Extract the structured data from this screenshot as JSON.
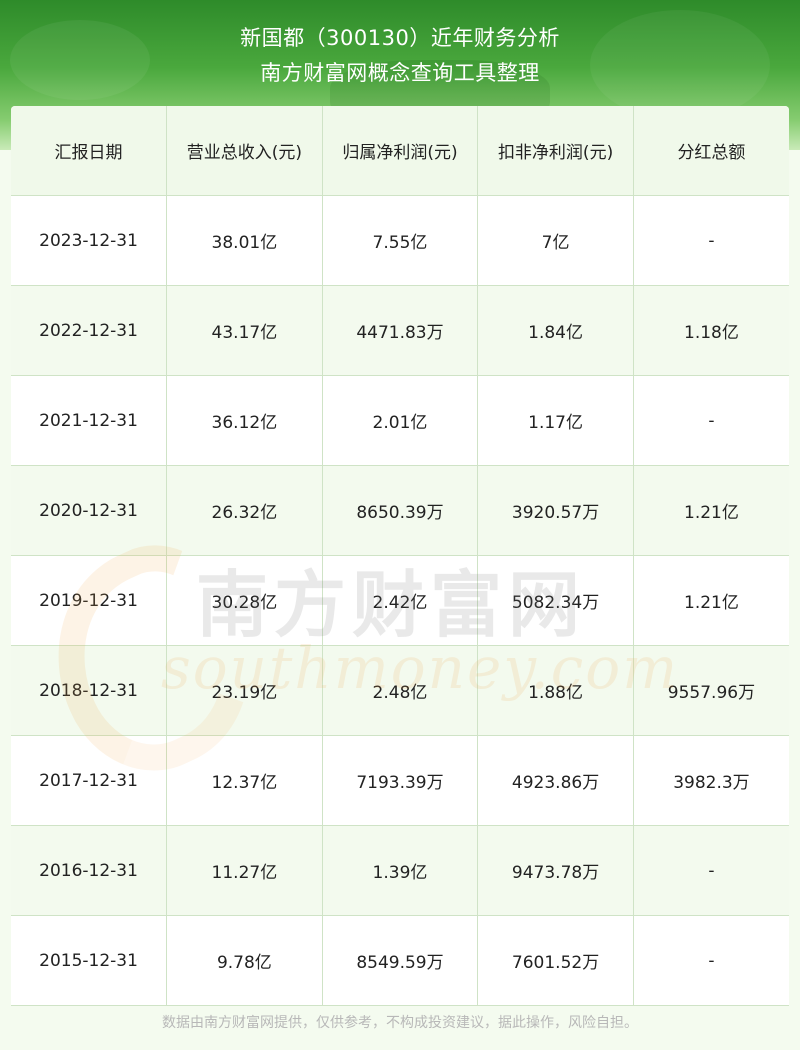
{
  "header": {
    "title": "新国都（300130）近年财务分析",
    "subtitle": "南方财富网概念查询工具整理"
  },
  "table": {
    "columns": [
      "汇报日期",
      "营业总收入(元)",
      "归属净利润(元)",
      "扣非净利润(元)",
      "分红总额"
    ],
    "rows": [
      [
        "2023-12-31",
        "38.01亿",
        "7.55亿",
        "7亿",
        "-"
      ],
      [
        "2022-12-31",
        "43.17亿",
        "4471.83万",
        "1.84亿",
        "1.18亿"
      ],
      [
        "2021-12-31",
        "36.12亿",
        "2.01亿",
        "1.17亿",
        "-"
      ],
      [
        "2020-12-31",
        "26.32亿",
        "8650.39万",
        "3920.57万",
        "1.21亿"
      ],
      [
        "2019-12-31",
        "30.28亿",
        "2.42亿",
        "5082.34万",
        "1.21亿"
      ],
      [
        "2018-12-31",
        "23.19亿",
        "2.48亿",
        "1.88亿",
        "9557.96万"
      ],
      [
        "2017-12-31",
        "12.37亿",
        "7193.39万",
        "4923.86万",
        "3982.3万"
      ],
      [
        "2016-12-31",
        "11.27亿",
        "1.39亿",
        "9473.78万",
        "-"
      ],
      [
        "2015-12-31",
        "9.78亿",
        "8549.59万",
        "7601.52万",
        "-"
      ]
    ]
  },
  "watermark": {
    "cn": "南方财富网",
    "en": "southmoney.com"
  },
  "footer": {
    "disclaimer": "数据由南方财富网提供，仅供参考，不构成投资建议，据此操作，风险自担。"
  },
  "colors": {
    "header_green": "#3f9a36",
    "row_alt": "#f3faee",
    "grid_line": "#cfe3c6"
  }
}
